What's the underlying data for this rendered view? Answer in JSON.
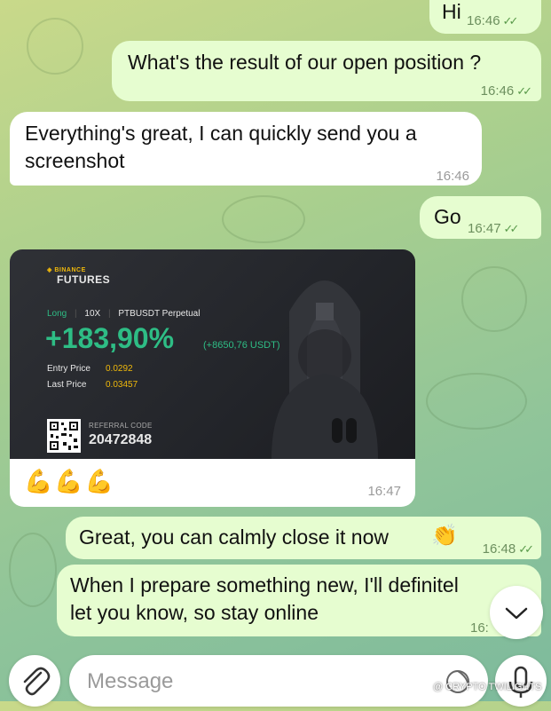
{
  "colors": {
    "outgoing_bubble": "#e6fdd0",
    "incoming_bubble": "#ffffff",
    "profit_green": "#2ebd85",
    "binance_gold": "#f0b90b"
  },
  "messages": [
    {
      "dir": "out",
      "text": "Hi",
      "time": "16:46"
    },
    {
      "dir": "out",
      "text": "What's the result of our open position ?",
      "time": "16:46"
    },
    {
      "dir": "in",
      "line1": "Everything's great, I can quickly send you a",
      "line2": "screenshot",
      "time": "16:46"
    },
    {
      "dir": "out",
      "text": "Go",
      "time": "16:47"
    },
    {
      "dir": "in",
      "type": "image",
      "emojis": "💪💪💪",
      "time": "16:47"
    },
    {
      "dir": "out",
      "text": "Great, you can calmly close it now",
      "emoji": "👏",
      "time": "16:48"
    },
    {
      "dir": "out",
      "line1": "When I prepare something new, I'll definitel",
      "line2": "let you know, so stay online",
      "time": "16:"
    }
  ],
  "card": {
    "brand_top": "BINANCE",
    "brand_bottom": "FUTURES",
    "side": "Long",
    "leverage": "10X",
    "pair": "PTBUSDT Perpetual",
    "roi": "+183,90%",
    "pnl": "(+8650,76 USDT)",
    "entry_label": "Entry Price",
    "entry_value": "0.0292",
    "last_label": "Last Price",
    "last_value": "0.03457",
    "referral_label": "REFERRAL CODE",
    "referral_code": "20472848"
  },
  "composer": {
    "placeholder": "Message",
    "watermark": "@ CRYPTO TWILIGHTS"
  },
  "icons": [
    "attach-icon",
    "sticker-icon",
    "mic-icon",
    "chevron-down-icon",
    "double-check-icon"
  ]
}
